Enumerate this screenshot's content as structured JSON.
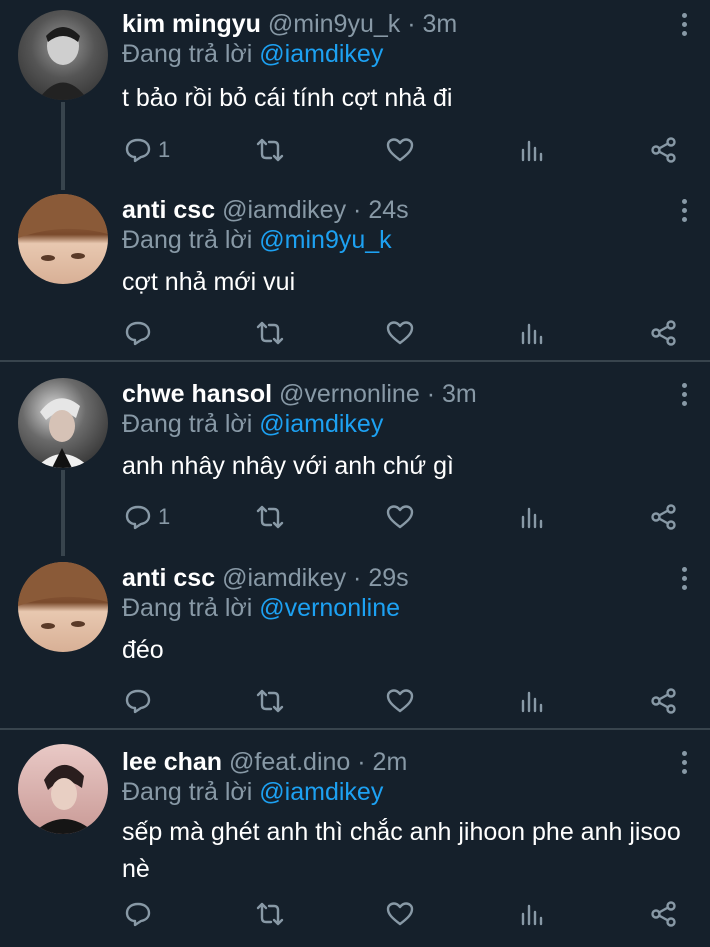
{
  "tweets": [
    {
      "name": "kim mingyu",
      "handle": "@min9yu_k",
      "time": "3m",
      "reply_prefix": "Đang trả lời",
      "reply_to": "@iamdikey",
      "text": "t bảo rồi bỏ cái tính cợt nhả đi",
      "reply_count": "1"
    },
    {
      "name": "anti csc",
      "handle": "@iamdikey",
      "time": "24s",
      "reply_prefix": "Đang trả lời",
      "reply_to": "@min9yu_k",
      "text": "cợt nhả mới vui",
      "reply_count": ""
    },
    {
      "name": "chwe hansol",
      "handle": "@vernonline",
      "time": "3m",
      "reply_prefix": "Đang trả lời",
      "reply_to": "@iamdikey",
      "text": "anh nhây nhây với anh chứ gì",
      "reply_count": "1"
    },
    {
      "name": "anti csc",
      "handle": "@iamdikey",
      "time": "29s",
      "reply_prefix": "Đang trả lời",
      "reply_to": "@vernonline",
      "text": "đéo",
      "reply_count": ""
    },
    {
      "name": "lee chan",
      "handle": "@feat.dino",
      "time": "2m",
      "reply_prefix": "Đang trả lời",
      "reply_to": "@iamdikey",
      "text": "sếp mà ghét anh thì chắc anh jihoon phe anh jisoo nè",
      "reply_count": ""
    }
  ],
  "separator": "·",
  "colors": {
    "background": "#15202b",
    "secondary_text": "#8899a6",
    "mention": "#1da1f2",
    "divider": "#38444d"
  },
  "icons": [
    "reply-icon",
    "retweet-icon",
    "like-icon",
    "analytics-icon",
    "share-icon",
    "more-options-icon"
  ]
}
